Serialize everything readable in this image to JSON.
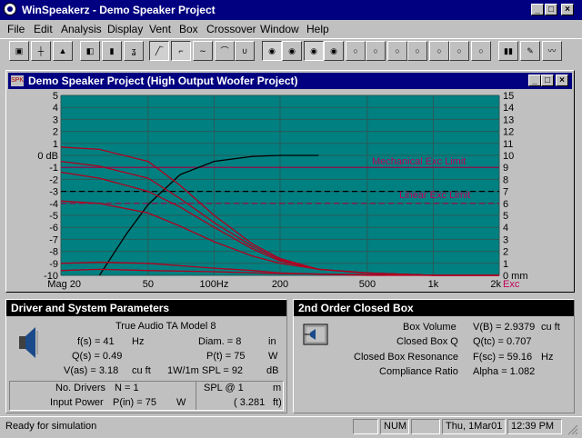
{
  "app": {
    "title": "WinSpeakerz - Demo Speaker Project",
    "colors": {
      "titlebar": "#000080",
      "plot_bg": "#008080"
    }
  },
  "menu": [
    "File",
    "Edit",
    "Analysis",
    "Display",
    "Vent",
    "Box",
    "Crossover",
    "Window",
    "Help"
  ],
  "toolbar": {
    "icons": [
      "open-icon",
      "schematic-icon",
      "car-icon",
      "driver-icon",
      "speaker-icon",
      "ear-icon",
      "response-icon",
      "highpass-icon",
      "bandpass-icon",
      "lowpass-icon",
      "notch-icon",
      "box-w-icon",
      "box-1-icon",
      "box-2-icon",
      "box-3-icon",
      "box-4-icon",
      "box-5-icon",
      "box-6-icon",
      "box-7-icon",
      "box-8-icon",
      "box-9-icon",
      "box-10-icon",
      "bars-icon",
      "edit-icon",
      "wave-icon"
    ]
  },
  "child": {
    "title": "Demo Speaker Project (High Output Woofer Project)"
  },
  "chart_data": {
    "type": "line",
    "x_scale": "log",
    "xlim": [
      20,
      2000
    ],
    "x_ticks": [
      "Mag 20",
      "50",
      "100Hz",
      "200",
      "500",
      "1k",
      "2k"
    ],
    "ylim": [
      -10,
      5
    ],
    "y_ticks_left": [
      "5",
      "4",
      "3",
      "2",
      "1",
      "0 dB",
      "-1",
      "-2",
      "-3",
      "-4",
      "-5",
      "-6",
      "-7",
      "-8",
      "-9",
      "-10"
    ],
    "y_ticks_right": [
      "15",
      "14",
      "13",
      "12",
      "11",
      "10",
      "9",
      "8",
      "7",
      "6",
      "5",
      "4",
      "3",
      "2",
      "1",
      "0 mm"
    ],
    "right_axis_label": "Exc",
    "annotations": [
      {
        "text": "Mechanical Exc Limit",
        "y": -1
      },
      {
        "text": "Linear Exc Limit",
        "y": -3.8
      }
    ],
    "series": [
      {
        "color": "#000000",
        "x": [
          30,
          40,
          50,
          70,
          100,
          150,
          200,
          300
        ],
        "y": [
          -10,
          -6.5,
          -4.1,
          -1.6,
          -0.5,
          -0.08,
          0,
          0
        ]
      },
      {
        "color": "#b00020",
        "x": [
          20,
          30,
          50,
          70,
          100,
          150,
          200,
          300,
          500,
          1000,
          2000
        ],
        "y": [
          0.7,
          0.5,
          -0.5,
          -2.5,
          -5,
          -7.4,
          -8.6,
          -9.5,
          -9.8,
          -10,
          -10
        ]
      },
      {
        "color": "#b00020",
        "x": [
          20,
          30,
          50,
          70,
          100,
          150,
          200,
          300,
          500,
          1000,
          2000
        ],
        "y": [
          -0.5,
          -0.9,
          -1.9,
          -3.6,
          -5.6,
          -7.6,
          -8.7,
          -9.5,
          -9.8,
          -10,
          -10
        ]
      },
      {
        "color": "#b00020",
        "x": [
          20,
          30,
          50,
          70,
          100,
          150,
          200,
          300,
          500,
          1000,
          2000
        ],
        "y": [
          -1.4,
          -1.9,
          -3,
          -4.3,
          -6,
          -7.8,
          -8.8,
          -9.5,
          -9.8,
          -10,
          -10
        ]
      },
      {
        "color": "#b00020",
        "x": [
          20,
          30,
          50,
          70,
          100,
          150,
          200,
          300,
          500,
          1000,
          2000
        ],
        "y": [
          -3.8,
          -4,
          -4.8,
          -5.9,
          -7.2,
          -8.4,
          -9,
          -9.5,
          -9.8,
          -10,
          -10
        ]
      },
      {
        "color": "#b00020",
        "x": [
          20,
          30,
          50,
          70,
          100,
          150,
          200,
          300,
          500,
          1000,
          2000
        ],
        "y": [
          -9,
          -8.9,
          -9,
          -9.2,
          -9.4,
          -9.6,
          -9.8,
          -9.9,
          -10,
          -10,
          -10
        ]
      },
      {
        "color": "#b00020",
        "x": [
          20,
          30,
          50,
          100,
          200,
          500,
          1000,
          2000
        ],
        "y": [
          -9.6,
          -9.5,
          -9.6,
          -9.7,
          -9.85,
          -9.95,
          -10,
          -10
        ]
      }
    ],
    "hlines": [
      {
        "y": -1,
        "color": "#a0004a",
        "style": "solid"
      },
      {
        "y": -3,
        "color": "#000000",
        "style": "dash"
      },
      {
        "y": -4,
        "color": "#a0004a",
        "style": "dash"
      }
    ]
  },
  "driver_panel": {
    "title": "Driver and System Parameters",
    "model": "True Audio TA Model 8",
    "fs": "f(s) = 41",
    "fs_unit": "Hz",
    "qs": "Q(s) = 0.49",
    "vas": "V(as) = 3.18",
    "vas_unit": "cu ft",
    "diam": "Diam. = 8",
    "diam_unit": "in",
    "pt": "P(t) = 75",
    "pt_unit": "W",
    "spl": "1W/1m SPL = 92",
    "spl_unit": "dB",
    "drivers_label": "No. Drivers",
    "drivers_value": "N = 1",
    "power_label": "Input Power",
    "power_value": "P(in) = 75",
    "power_unit": "W",
    "spl_at": "SPL @ 1",
    "spl_at_unit": "m",
    "spl_ft": "( 3.281",
    "spl_ft_unit": "ft)"
  },
  "box_panel": {
    "title": "2nd Order Closed Box",
    "rows": [
      {
        "label": "Box Volume",
        "value": "V(B) = 2.9379",
        "unit": "cu ft"
      },
      {
        "label": "Closed Box Q",
        "value": "Q(tc) = 0.707",
        "unit": ""
      },
      {
        "label": "Closed Box Resonance",
        "value": "F(sc) = 59.16",
        "unit": "Hz"
      },
      {
        "label": "Compliance Ratio",
        "value": "Alpha = 1.082",
        "unit": ""
      }
    ]
  },
  "status": {
    "text": "Ready for simulation",
    "num": "NUM",
    "date": "Thu, 1Mar01",
    "time": "12:39 PM"
  }
}
